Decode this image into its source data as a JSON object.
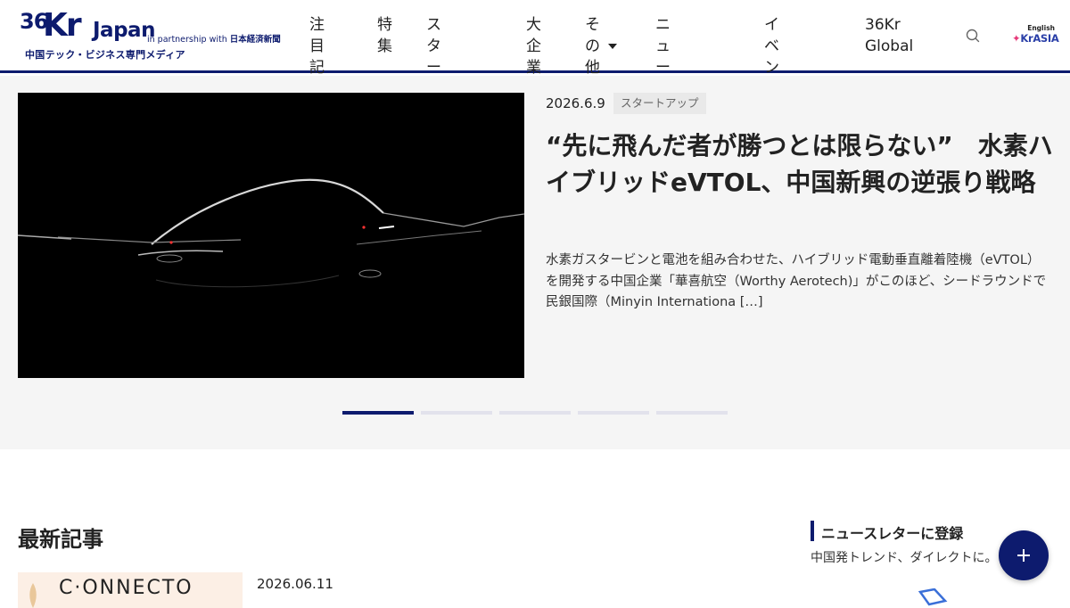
{
  "logo": {
    "n36": "36",
    "kr": "Kr",
    "japan": "Japan",
    "partner_prefix": "in partnership with",
    "partner_name": "日本経済新聞",
    "tagline": "中国テック・ビジネス専門メディア"
  },
  "nav": {
    "items": [
      {
        "label": "注目\n記事"
      },
      {
        "label": "特\n集"
      },
      {
        "label": "スタート\nアップ"
      },
      {
        "label": "大企\n業"
      },
      {
        "label": "その\n他"
      },
      {
        "label": "ニュースレ\nター"
      },
      {
        "label": "イベント\n情報"
      },
      {
        "label": "36Kr\nGlobal"
      }
    ],
    "search_icon": "search-icon",
    "language": "English",
    "krasia_logo": "KrASIA"
  },
  "hero": {
    "date": "2026.6.9",
    "tag": "スタートアップ",
    "title": "“先に飛んだ者が勝つとは限らない”　水素ハイブリッドeVTOL、中国新興の逆張り戦略",
    "description": "水素ガスタービンと電池を組み合わせた、ハイブリッド電動垂直離着陸機（eVTOL）を開発する中国企業「華喜航空（Worthy Aerotech)」がこのほど、シードラウンドで民銀国際（Minyin Internationa […]",
    "slides": 5,
    "active_slide": 1
  },
  "latest": {
    "heading": "最新記事",
    "articles": [
      {
        "thumb_text": "C·ONNECTO",
        "date": "2026.06.11"
      }
    ]
  },
  "newsletter": {
    "title": "ニュースレターに登録",
    "subtitle": "中国発トレンド、ダイレクトに。"
  },
  "colors": {
    "brand": "#0d1b6e",
    "hero_bg": "#f5f5f5",
    "inactive_dot": "#e2e2ec"
  }
}
